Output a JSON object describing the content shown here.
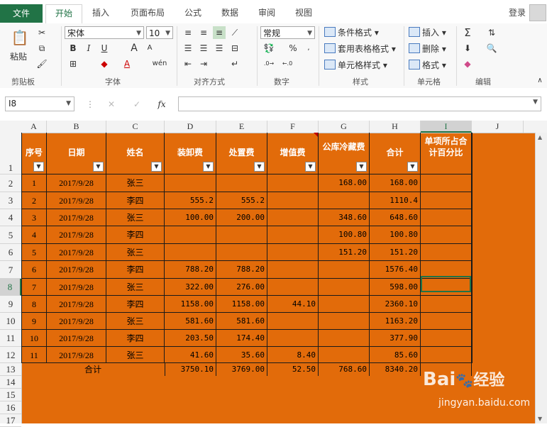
{
  "tabs": [
    "文件",
    "开始",
    "插入",
    "页面布局",
    "公式",
    "数据",
    "审阅",
    "视图"
  ],
  "login": "登录",
  "ribbon": {
    "clipboard": {
      "label": "剪贴板",
      "paste": "粘贴"
    },
    "font": {
      "label": "字体",
      "name": "宋体",
      "size": "10",
      "bold": "B",
      "italic": "I",
      "underline": "U",
      "grow": "A",
      "shrink": "A",
      "wen": "wén"
    },
    "align": {
      "label": "对齐方式"
    },
    "number": {
      "label": "数字",
      "format": "常规",
      "percent": "%"
    },
    "styles": {
      "label": "样式",
      "cond": "条件格式",
      "table": "套用表格格式",
      "cell": "单元格样式"
    },
    "cells": {
      "label": "单元格",
      "insert": "插入",
      "delete": "删除",
      "format": "格式"
    },
    "editing": {
      "label": "编辑"
    }
  },
  "name_box": "I8",
  "fx": "fx",
  "columns": [
    "A",
    "B",
    "C",
    "D",
    "E",
    "F",
    "G",
    "H",
    "I",
    "J"
  ],
  "rows": [
    "1",
    "2",
    "3",
    "4",
    "5",
    "6",
    "7",
    "8",
    "9",
    "10",
    "11",
    "12",
    "13",
    "14",
    "15",
    "16",
    "17"
  ],
  "headers": [
    "序号",
    "日期",
    "姓名",
    "装卸费",
    "处置费",
    "增值费",
    "公库冷藏费",
    "合计",
    "单项所占合计百分比"
  ],
  "data_rows": [
    [
      "1",
      "2017/9/28",
      "张三",
      "",
      "",
      "",
      "168.00",
      "168.00"
    ],
    [
      "2",
      "2017/9/28",
      "李四",
      "555.2",
      "555.2",
      "",
      "",
      "1110.4"
    ],
    [
      "3",
      "2017/9/28",
      "张三",
      "100.00",
      "200.00",
      "",
      "348.60",
      "648.60"
    ],
    [
      "4",
      "2017/9/28",
      "李四",
      "",
      "",
      "",
      "100.80",
      "100.80"
    ],
    [
      "5",
      "2017/9/28",
      "张三",
      "",
      "",
      "",
      "151.20",
      "151.20"
    ],
    [
      "6",
      "2017/9/28",
      "李四",
      "788.20",
      "788.20",
      "",
      "",
      "1576.40"
    ],
    [
      "7",
      "2017/9/28",
      "张三",
      "322.00",
      "276.00",
      "",
      "",
      "598.00"
    ],
    [
      "8",
      "2017/9/28",
      "李四",
      "1158.00",
      "1158.00",
      "44.10",
      "",
      "2360.10"
    ],
    [
      "9",
      "2017/9/28",
      "张三",
      "581.60",
      "581.60",
      "",
      "",
      "1163.20"
    ],
    [
      "10",
      "2017/9/28",
      "李四",
      "203.50",
      "174.40",
      "",
      "",
      "377.90"
    ],
    [
      "11",
      "2017/9/28",
      "张三",
      "41.60",
      "35.60",
      "8.40",
      "",
      "85.60"
    ]
  ],
  "total_row": {
    "label": "合计",
    "values": [
      "3750.10",
      "3769.00",
      "52.50",
      "768.60",
      "8340.20"
    ]
  },
  "watermark": {
    "brand": "Bai",
    "brand2": "经验",
    "url": "jingyan.baidu.com"
  }
}
